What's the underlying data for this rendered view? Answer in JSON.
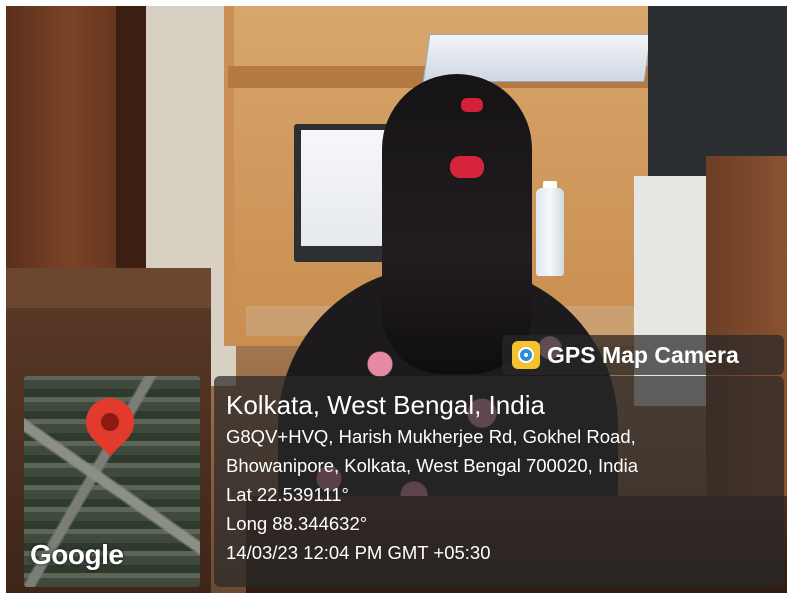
{
  "overlay": {
    "brand": "GPS Map Camera",
    "brand_icon": "camera-icon",
    "map_logo": "Google",
    "map_pin_icon": "map-pin-icon",
    "location_title": "Kolkata, West Bengal, India",
    "address_line_1": "G8QV+HVQ, Harish Mukherjee Rd, Gokhel Road,",
    "address_line_2": "Bhowanipore, Kolkata, West Bengal 700020, India",
    "latitude": "Lat 22.539111°",
    "longitude": "Long 88.344632°",
    "timestamp": "14/03/23 12:04 PM GMT +05:30"
  },
  "colors": {
    "panel_background": "#282828",
    "pin_red": "#e23b2e",
    "text": "#ffffff"
  }
}
